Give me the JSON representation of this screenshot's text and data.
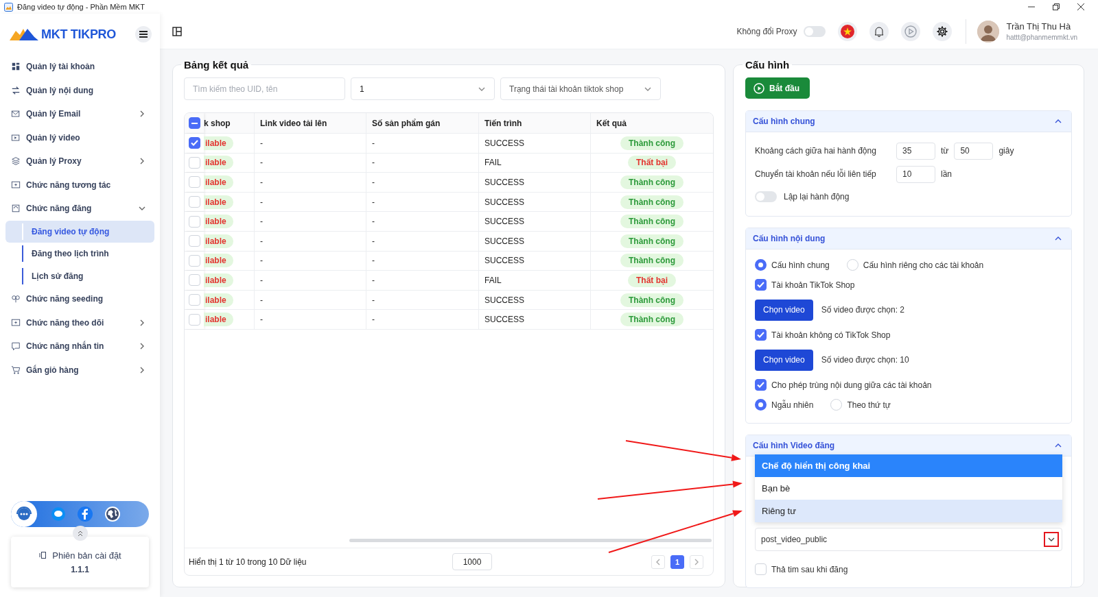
{
  "window": {
    "title": "Đăng video tự động - Phần Mềm MKT"
  },
  "sidebar": {
    "logo": "MKT TIKPRO",
    "items": [
      {
        "label": "Quản lý tài khoản",
        "selected": false
      },
      {
        "label": "Quản lý nội dung",
        "selected": false
      },
      {
        "label": "Quản lý Email",
        "selected": false,
        "expanded": false
      },
      {
        "label": "Quản lý video",
        "selected": false
      },
      {
        "label": "Quản lý Proxy",
        "selected": false,
        "expanded": false
      },
      {
        "label": "Chức năng tương tác",
        "selected": false
      },
      {
        "label": "Chức năng đăng",
        "selected": false,
        "expanded": true,
        "children": [
          {
            "label": "Đăng video tự động",
            "selected": true
          },
          {
            "label": "Đăng theo lịch trình",
            "selected": false
          },
          {
            "label": "Lịch sử đăng",
            "selected": false
          }
        ]
      },
      {
        "label": "Chức năng seeding",
        "selected": false
      },
      {
        "label": "Chức năng theo dõi",
        "selected": false,
        "expanded": false
      },
      {
        "label": "Chức năng nhắn tin",
        "selected": false,
        "expanded": false
      },
      {
        "label": "Gắn giỏ hàng",
        "selected": false,
        "expanded": false
      }
    ],
    "version": {
      "label": "Phiên bản cài đặt",
      "number": "1.1.1"
    }
  },
  "topbar": {
    "proxy_label": "Không đổi Proxy",
    "proxy_on": false,
    "user": {
      "name": "Trần Thị Thu Hà",
      "email": "hattt@phanmemmkt.vn"
    }
  },
  "results": {
    "title": "Bảng kết quả",
    "search": {
      "placeholder": "Tìm kiếm theo UID, tên"
    },
    "filters": [
      {
        "value": "1"
      },
      {
        "placeholder": "Trạng thái tài khoản tiktok shop"
      }
    ],
    "select_all_indeterminate": true,
    "columns": [
      "k shop",
      "Link video tải lên",
      "Số sản phẩm gán",
      "Tiến trình",
      "Kết quả"
    ],
    "rows": [
      {
        "selected": true,
        "shop": "ilable",
        "link": "-",
        "products": "-",
        "progress": "SUCCESS",
        "result": "Thành công",
        "kind": "success"
      },
      {
        "selected": false,
        "shop": "ilable",
        "link": "-",
        "products": "-",
        "progress": "FAIL",
        "result": "Thất bại",
        "kind": "fail"
      },
      {
        "selected": false,
        "shop": "ilable",
        "link": "-",
        "products": "-",
        "progress": "SUCCESS",
        "result": "Thành công",
        "kind": "success"
      },
      {
        "selected": false,
        "shop": "ilable",
        "link": "-",
        "products": "-",
        "progress": "SUCCESS",
        "result": "Thành công",
        "kind": "success"
      },
      {
        "selected": false,
        "shop": "ilable",
        "link": "-",
        "products": "-",
        "progress": "SUCCESS",
        "result": "Thành công",
        "kind": "success"
      },
      {
        "selected": false,
        "shop": "ilable",
        "link": "-",
        "products": "-",
        "progress": "SUCCESS",
        "result": "Thành công",
        "kind": "success"
      },
      {
        "selected": false,
        "shop": "ilable",
        "link": "-",
        "products": "-",
        "progress": "SUCCESS",
        "result": "Thành công",
        "kind": "success"
      },
      {
        "selected": false,
        "shop": "ilable",
        "link": "-",
        "products": "-",
        "progress": "FAIL",
        "result": "Thất bại",
        "kind": "fail"
      },
      {
        "selected": false,
        "shop": "ilable",
        "link": "-",
        "products": "-",
        "progress": "SUCCESS",
        "result": "Thành công",
        "kind": "success"
      },
      {
        "selected": false,
        "shop": "ilable",
        "link": "-",
        "products": "-",
        "progress": "SUCCESS",
        "result": "Thành công",
        "kind": "success"
      }
    ],
    "footer": {
      "summary": "Hiển thị 1 từ 10 trong 10 Dữ liệu",
      "page_size": "1000",
      "pages": [
        {
          "label": "1",
          "selected": true
        }
      ]
    }
  },
  "config": {
    "title": "Cấu hình",
    "start_button": "Bắt đầu",
    "general": {
      "title": "Cấu hình chung",
      "expanded": true,
      "delay_label": "Khoảng cách giữa hai hành động",
      "delay_from": "35",
      "delay_between": "từ",
      "delay_to": "50",
      "delay_unit": "giây",
      "switch_label": "Chuyển tài khoản nếu lỗi liên tiếp",
      "switch_value": "10",
      "switch_unit": "lần",
      "repeat_label": "Lập lại hành động",
      "repeat_on": false
    },
    "content": {
      "title": "Cấu hình nội dung",
      "expanded": true,
      "modes": [
        {
          "label": "Cấu hình chung",
          "selected": true
        },
        {
          "label": "Cấu hình riêng cho các tài khoản",
          "selected": false
        }
      ],
      "groups": [
        {
          "label": "Tài khoản TikTok Shop",
          "checked": true,
          "button": "Chọn video",
          "count": "Số video được chọn: 2"
        },
        {
          "label": "Tài khoản không có TikTok Shop",
          "checked": true,
          "button": "Chọn video",
          "count": "Số video được chọn: 10"
        }
      ],
      "duplicate_label": "Cho phép trùng nội dung giữa các tài khoản",
      "duplicate_checked": true,
      "orders": [
        {
          "label": "Ngẫu nhiên",
          "selected": true
        },
        {
          "label": "Theo thứ tự",
          "selected": false
        }
      ]
    },
    "video": {
      "title": "Cấu hình Video đăng",
      "expanded": true,
      "privacy_value": "post_video_public",
      "privacy_open": true,
      "options": [
        {
          "label": "Chế độ hiển thị công khai",
          "selected": true,
          "highlighted": false
        },
        {
          "label": "Bạn bè",
          "selected": false,
          "highlighted": false
        },
        {
          "label": "Riêng tư",
          "selected": false,
          "highlighted": true
        }
      ],
      "like_label": "Thả tim sau khi đăng",
      "like_checked": false
    }
  }
}
